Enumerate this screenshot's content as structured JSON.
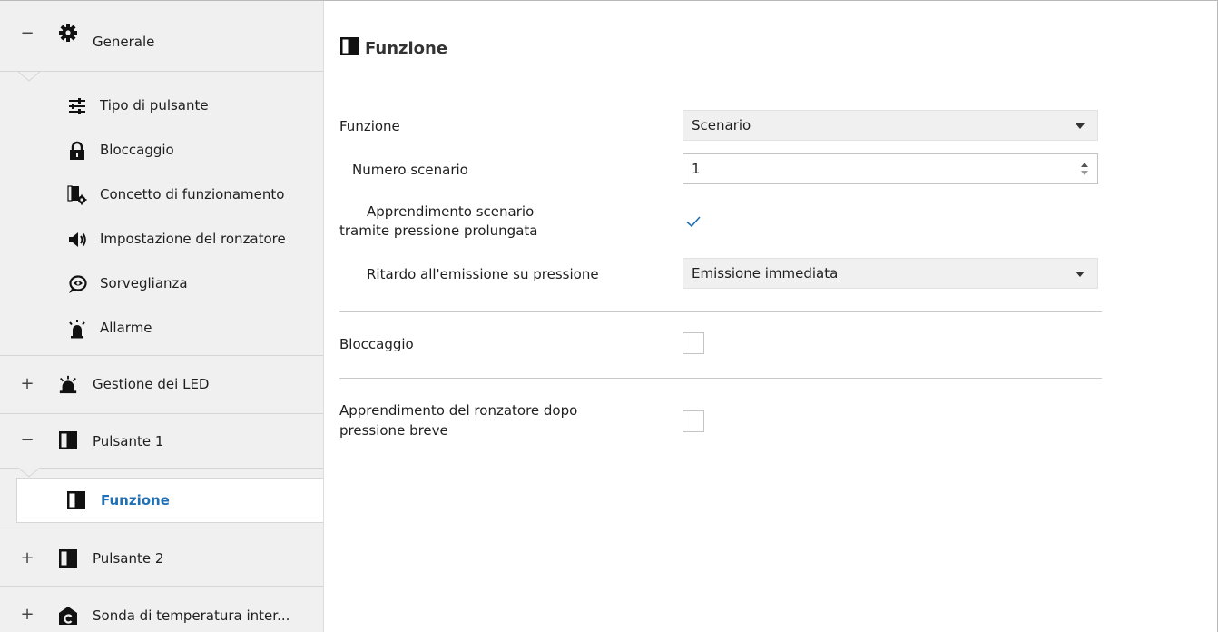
{
  "sidebar": {
    "generale": {
      "expander": "−",
      "label": "Generale"
    },
    "sub_items": [
      {
        "label": "Tipo di pulsante"
      },
      {
        "label": "Bloccaggio"
      },
      {
        "label": "Concetto di funzionamento"
      },
      {
        "label": "Impostazione del ronzatore"
      },
      {
        "label": "Sorveglianza"
      },
      {
        "label": "Allarme"
      }
    ],
    "gestione_led": {
      "expander": "+",
      "label": "Gestione dei LED"
    },
    "pulsante1": {
      "expander": "−",
      "label": "Pulsante 1"
    },
    "selected": {
      "label": "Funzione"
    },
    "pulsante2": {
      "expander": "+",
      "label": "Pulsante 2"
    },
    "sonda": {
      "expander": "+",
      "label": "Sonda di temperatura inter..."
    }
  },
  "main": {
    "title": "Funzione",
    "fields": {
      "funzione": {
        "label": "Funzione",
        "value": "Scenario"
      },
      "numero_scenario": {
        "label": "Numero scenario",
        "value": "1"
      },
      "apprendimento": {
        "label_line1": "Apprendimento scenario",
        "label_line2": "tramite pressione prolungata",
        "checked": true
      },
      "ritardo": {
        "label": "Ritardo all'emissione su pressione",
        "value": "Emissione immediata"
      },
      "bloccaggio": {
        "label": "Bloccaggio",
        "checked": false
      },
      "ronzatore": {
        "label_line1": "Apprendimento del ronzatore dopo",
        "label_line2": "pressione breve",
        "checked": false
      }
    }
  },
  "colors": {
    "accent": "#1f6fb5",
    "sidebar_bg": "#f0f0f0"
  }
}
